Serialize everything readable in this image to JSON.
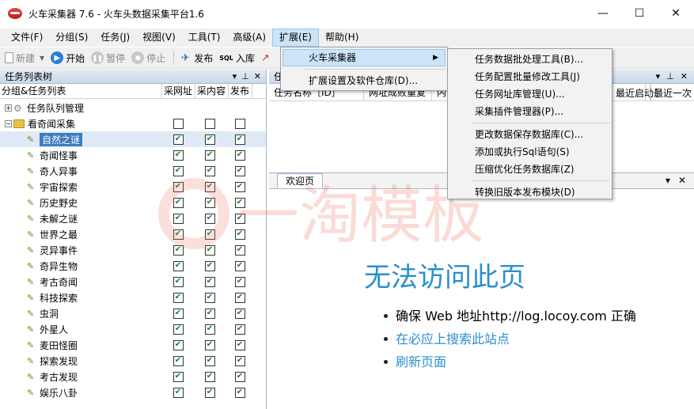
{
  "window": {
    "title": "火车采集器 7.6 - 火车头数据采集平台1.6",
    "controls": [
      "—",
      "☐",
      "✕"
    ]
  },
  "menubar": {
    "items": [
      "文件(F)",
      "分组(S)",
      "任务(J)",
      "视图(V)",
      "工具(T)",
      "高级(A)",
      "扩展(E)",
      "帮助(H)"
    ]
  },
  "toolbar": {
    "new": "新建",
    "start": "开始",
    "pause": "暂停",
    "stop": "停止",
    "publish": "发布",
    "import": "入库",
    "sql_icon_text": "SQL"
  },
  "left_panel": {
    "title": "任务列表树",
    "columns": [
      "分组&任务列表",
      "采网址",
      "采内容",
      "发布"
    ],
    "queue_node": "任务队列管理",
    "group_node": "看奇闻采集",
    "tasks": [
      "自然之谜",
      "奇闻怪事",
      "奇人异事",
      "宇宙探索",
      "历史野史",
      "未解之谜",
      "世界之最",
      "灵异事件",
      "奇异生物",
      "考古奇闻",
      "科技探索",
      "虫洞",
      "外星人",
      "麦田怪圈",
      "探索发现",
      "考古发现",
      "娱乐八卦"
    ]
  },
  "right_top": {
    "title_prefix": "任",
    "columns": [
      "任务名称［ID］",
      "网址成败重复",
      "内",
      "",
      "最近启动于",
      "最近一次"
    ]
  },
  "browser": {
    "tab": "欢迎页",
    "heading": "无法访问此页",
    "items": [
      "确保 Web 地址http://log.locoy.com 正确",
      "在必应上搜索此站点",
      "刷新页面"
    ]
  },
  "watermark": {
    "text": "一淘模板"
  },
  "menu_extend": {
    "items": [
      "火车采集器",
      "扩展设置及软件仓库(D)..."
    ]
  },
  "submenu": {
    "items": [
      "任务数据批处理工具(B)...",
      "任务配置批量修改工具(J)",
      "任务网址库管理(U)...",
      "采集插件管理器(P)...",
      "更改数据保存数据库(C)...",
      "添加或执行Sql语句(S)",
      "压缩优化任务数据库(Z)",
      "转换旧版本发布模块(D)"
    ]
  }
}
